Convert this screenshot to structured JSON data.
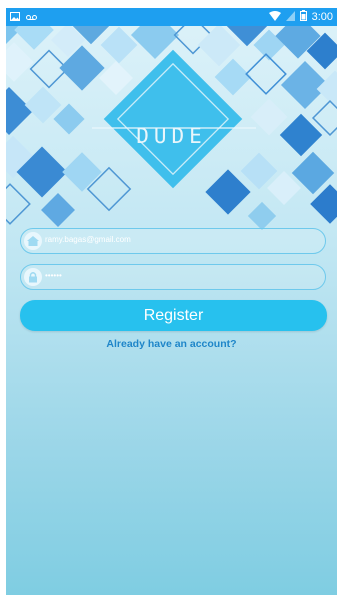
{
  "status_bar": {
    "time": "3:00",
    "left_icons": [
      "image-icon",
      "voicemail-icon"
    ],
    "right_icons": [
      "wifi-icon",
      "signal-icon",
      "battery-icon"
    ]
  },
  "hero": {
    "logo": "DUDE"
  },
  "form": {
    "email": {
      "value": "ramy.bagas@gmail.com",
      "icon": "home-icon"
    },
    "password": {
      "value": "••••••",
      "icon": "lock-icon"
    },
    "register_label": "Register",
    "account_link": "Already have an account?"
  },
  "colors": {
    "status_bar": "#1e9ff0",
    "accent": "#27c1ee",
    "link": "#1f86c9",
    "field_border": "#6ec9ec"
  }
}
